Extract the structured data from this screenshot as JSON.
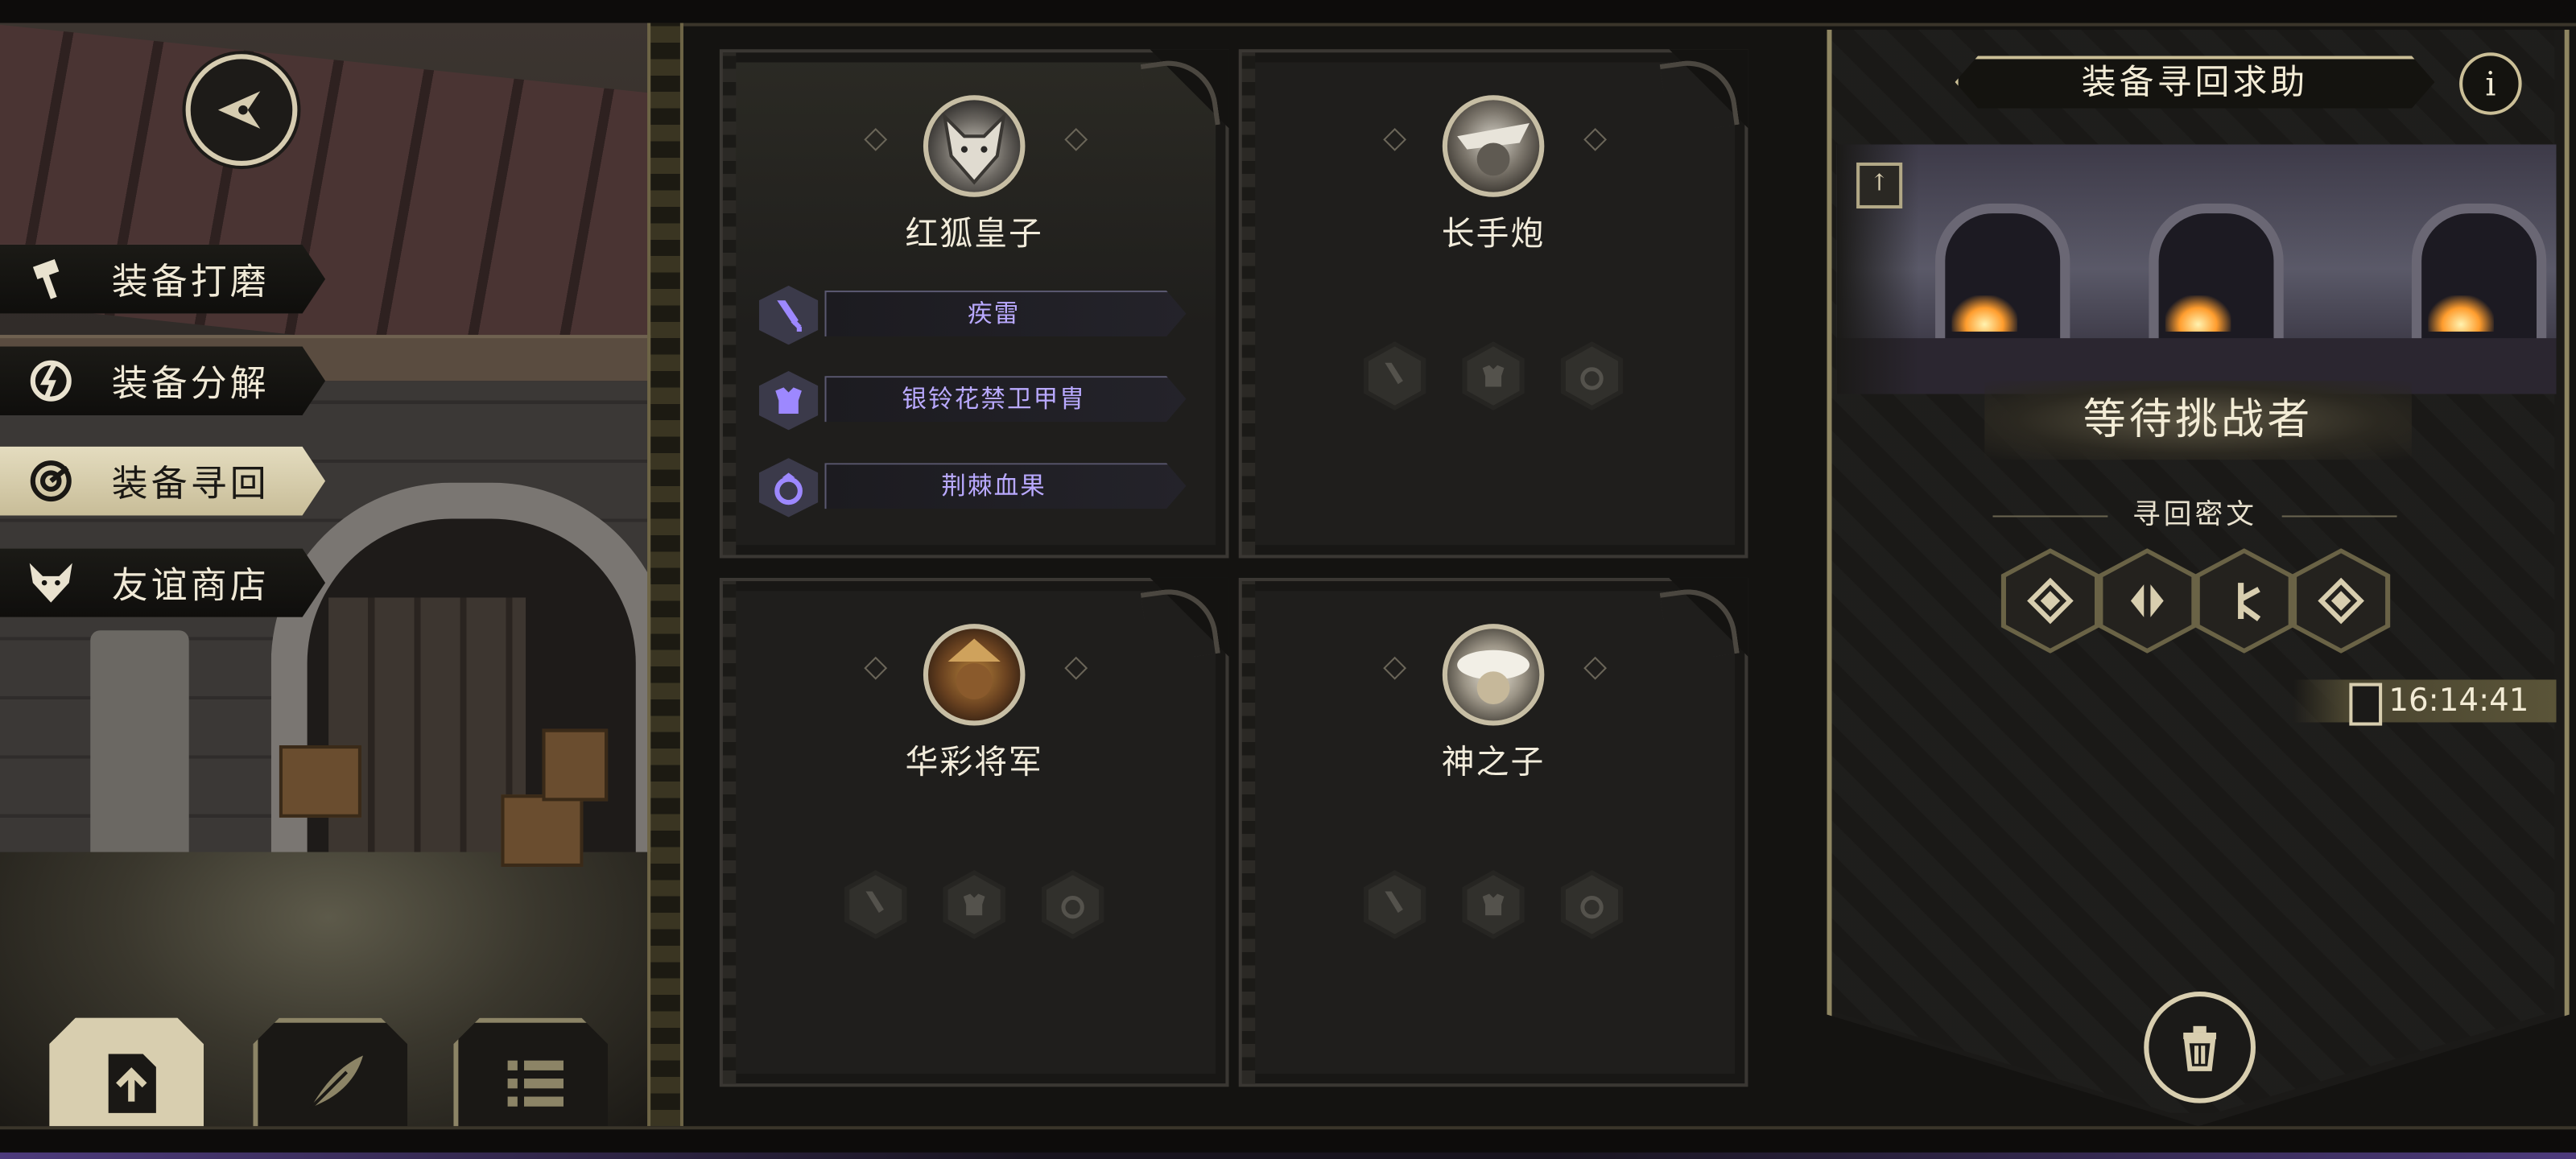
{
  "left_menu": {
    "items": [
      {
        "label": "装备打磨",
        "icon": "hammer-icon",
        "active": false
      },
      {
        "label": "装备分解",
        "icon": "decompose-icon",
        "active": false
      },
      {
        "label": "装备寻回",
        "icon": "retrieve-icon",
        "active": true
      },
      {
        "label": "友谊商店",
        "icon": "fox-icon",
        "active": false
      }
    ]
  },
  "bottom_tabs": [
    {
      "icon": "upload-icon",
      "active": true
    },
    {
      "icon": "feather-icon",
      "active": false
    },
    {
      "icon": "list-icon",
      "active": false
    }
  ],
  "cards": [
    {
      "name": "红狐皇子",
      "portrait": "fox-prince-portrait",
      "equipment": [
        {
          "name": "疾雷",
          "icon": "sword-icon"
        },
        {
          "name": "银铃花禁卫甲胄",
          "icon": "armor-icon"
        },
        {
          "name": "荆棘血果",
          "icon": "ring-icon"
        }
      ]
    },
    {
      "name": "长手炮",
      "portrait": "long-cannon-portrait",
      "equipment": []
    },
    {
      "name": "华彩将军",
      "portrait": "general-portrait",
      "equipment": []
    },
    {
      "name": "神之子",
      "portrait": "god-son-portrait",
      "equipment": []
    }
  ],
  "right_panel": {
    "title": "装备寻回求助",
    "info": "i",
    "status": "等待挑战者",
    "cipher_label": "寻回密文",
    "runes": [
      "rune-diamond-icon",
      "rune-split-icon",
      "rune-branch-icon",
      "rune-diamond-icon"
    ],
    "timer": "16:14:41"
  },
  "colors": {
    "accent": "#cbbf97",
    "equip_text": "#b9a9ff",
    "panel_bg": "#1b1a18"
  }
}
